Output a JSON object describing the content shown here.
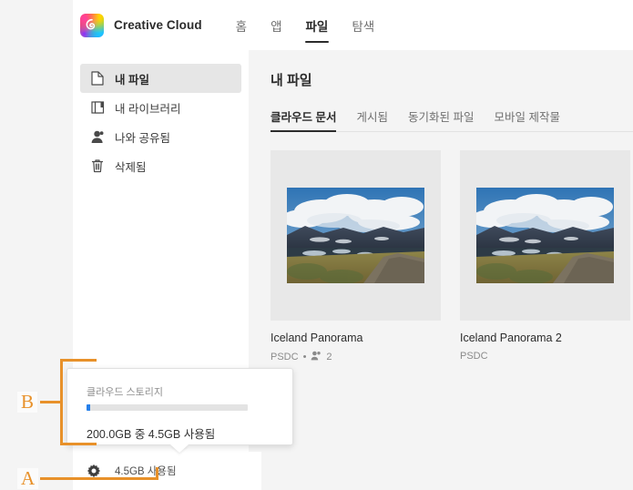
{
  "app": {
    "brand": "Creative Cloud",
    "logo_icon": "creative-cloud-logo-icon",
    "nav": [
      {
        "label": "홈",
        "active": false
      },
      {
        "label": "앱",
        "active": false
      },
      {
        "label": "파일",
        "active": true
      },
      {
        "label": "탐색",
        "active": false
      }
    ]
  },
  "sidebar": {
    "items": [
      {
        "label": "내 파일",
        "icon": "document-icon",
        "active": true
      },
      {
        "label": "내 라이브러리",
        "icon": "library-stack-icon",
        "active": false
      },
      {
        "label": "나와 공유됨",
        "icon": "person-icon",
        "active": false
      },
      {
        "label": "삭제됨",
        "icon": "trash-icon",
        "active": false
      }
    ]
  },
  "main": {
    "page_title": "내 파일",
    "tabs": [
      {
        "label": "클라우드 문서",
        "active": true
      },
      {
        "label": "게시됨",
        "active": false
      },
      {
        "label": "동기화된 파일",
        "active": false
      },
      {
        "label": "모바일 제작물",
        "active": false
      }
    ],
    "files": [
      {
        "name": "Iceland Panorama",
        "format": "PSDC",
        "shared_icon": "people-icon",
        "shared_count": "2",
        "separator": "•",
        "thumbnail": "iceland-landscape-photo"
      },
      {
        "name": "Iceland Panorama 2",
        "format": "PSDC",
        "thumbnail": "iceland-landscape-photo"
      }
    ]
  },
  "statusbar": {
    "gear_icon": "gear-icon",
    "storage_label": "4.5GB 사용됨"
  },
  "tooltip": {
    "title": "클라우드 스토리지",
    "detail": "200.0GB 중 4.5GB 사용됨",
    "used_percent": 2.25,
    "bar_color": "#2680eb",
    "track_color": "#e3e3e3"
  },
  "annotations": {
    "color": "#e8912a",
    "markers": [
      {
        "letter": "A",
        "target": "storage-status-button"
      },
      {
        "letter": "B",
        "target": "cloud-storage-tooltip"
      }
    ]
  }
}
